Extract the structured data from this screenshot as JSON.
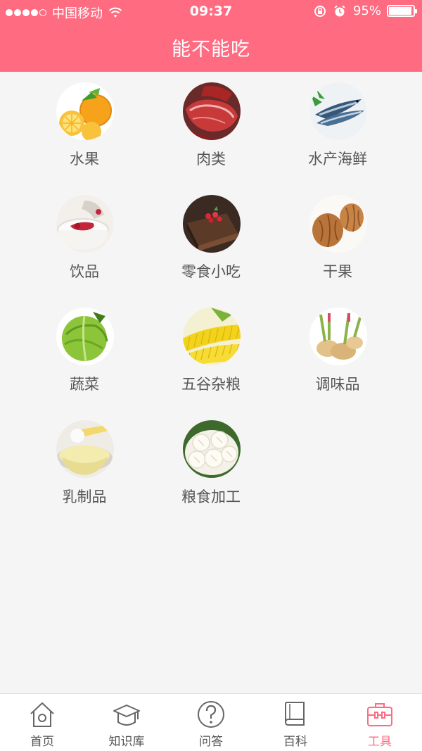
{
  "status_bar": {
    "carrier": "中国移动",
    "time": "09:37",
    "battery_percent": "95%",
    "battery_level": 0.95,
    "signal_strength": 4,
    "icons": [
      "signal-icon",
      "wifi-icon",
      "rotation-lock-icon",
      "alarm-icon",
      "battery-icon"
    ]
  },
  "header": {
    "title": "能不能吃"
  },
  "categories": [
    {
      "label": "水果",
      "icon": "fruit-image"
    },
    {
      "label": "肉类",
      "icon": "meat-image"
    },
    {
      "label": "水产海鲜",
      "icon": "seafood-image"
    },
    {
      "label": "饮品",
      "icon": "drinks-image"
    },
    {
      "label": "零食小吃",
      "icon": "snacks-image"
    },
    {
      "label": "干果",
      "icon": "nuts-image"
    },
    {
      "label": "蔬菜",
      "icon": "vegetables-image"
    },
    {
      "label": "五谷杂粮",
      "icon": "grains-image"
    },
    {
      "label": "调味品",
      "icon": "condiments-image"
    },
    {
      "label": "乳制品",
      "icon": "dairy-image"
    },
    {
      "label": "粮食加工",
      "icon": "processed-food-image"
    }
  ],
  "tabbar": {
    "items": [
      {
        "label": "首页",
        "icon": "home-icon",
        "active": false
      },
      {
        "label": "知识库",
        "icon": "graduation-cap-icon",
        "active": false
      },
      {
        "label": "问答",
        "icon": "question-icon",
        "active": false
      },
      {
        "label": "百科",
        "icon": "book-icon",
        "active": false
      },
      {
        "label": "工具",
        "icon": "toolbox-icon",
        "active": true
      }
    ]
  },
  "colors": {
    "accent": "#ff6b81",
    "background": "#f5f5f5",
    "label": "#555555",
    "tab_inactive": "#555555"
  }
}
